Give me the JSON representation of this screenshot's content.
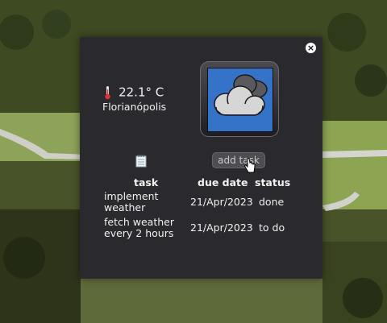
{
  "weather": {
    "temperature": "22.1° C",
    "city": "Florianópolis",
    "condition_icon": "cloudy-icon",
    "thermometer_icon": "thermometer-icon"
  },
  "controls": {
    "close_label": "×",
    "add_task_label": "add task"
  },
  "tasks": {
    "columns": [
      "task",
      "due date",
      "status"
    ],
    "rows": [
      {
        "task": "implement weather",
        "due": "21/Apr/2023",
        "status": "done"
      },
      {
        "task": "fetch weather every 2 hours",
        "due": "21/Apr/2023",
        "status": "to do"
      }
    ]
  },
  "colors": {
    "panel": "#2a2a2e",
    "sky": "#3573c9",
    "button": "#4d4d52"
  }
}
